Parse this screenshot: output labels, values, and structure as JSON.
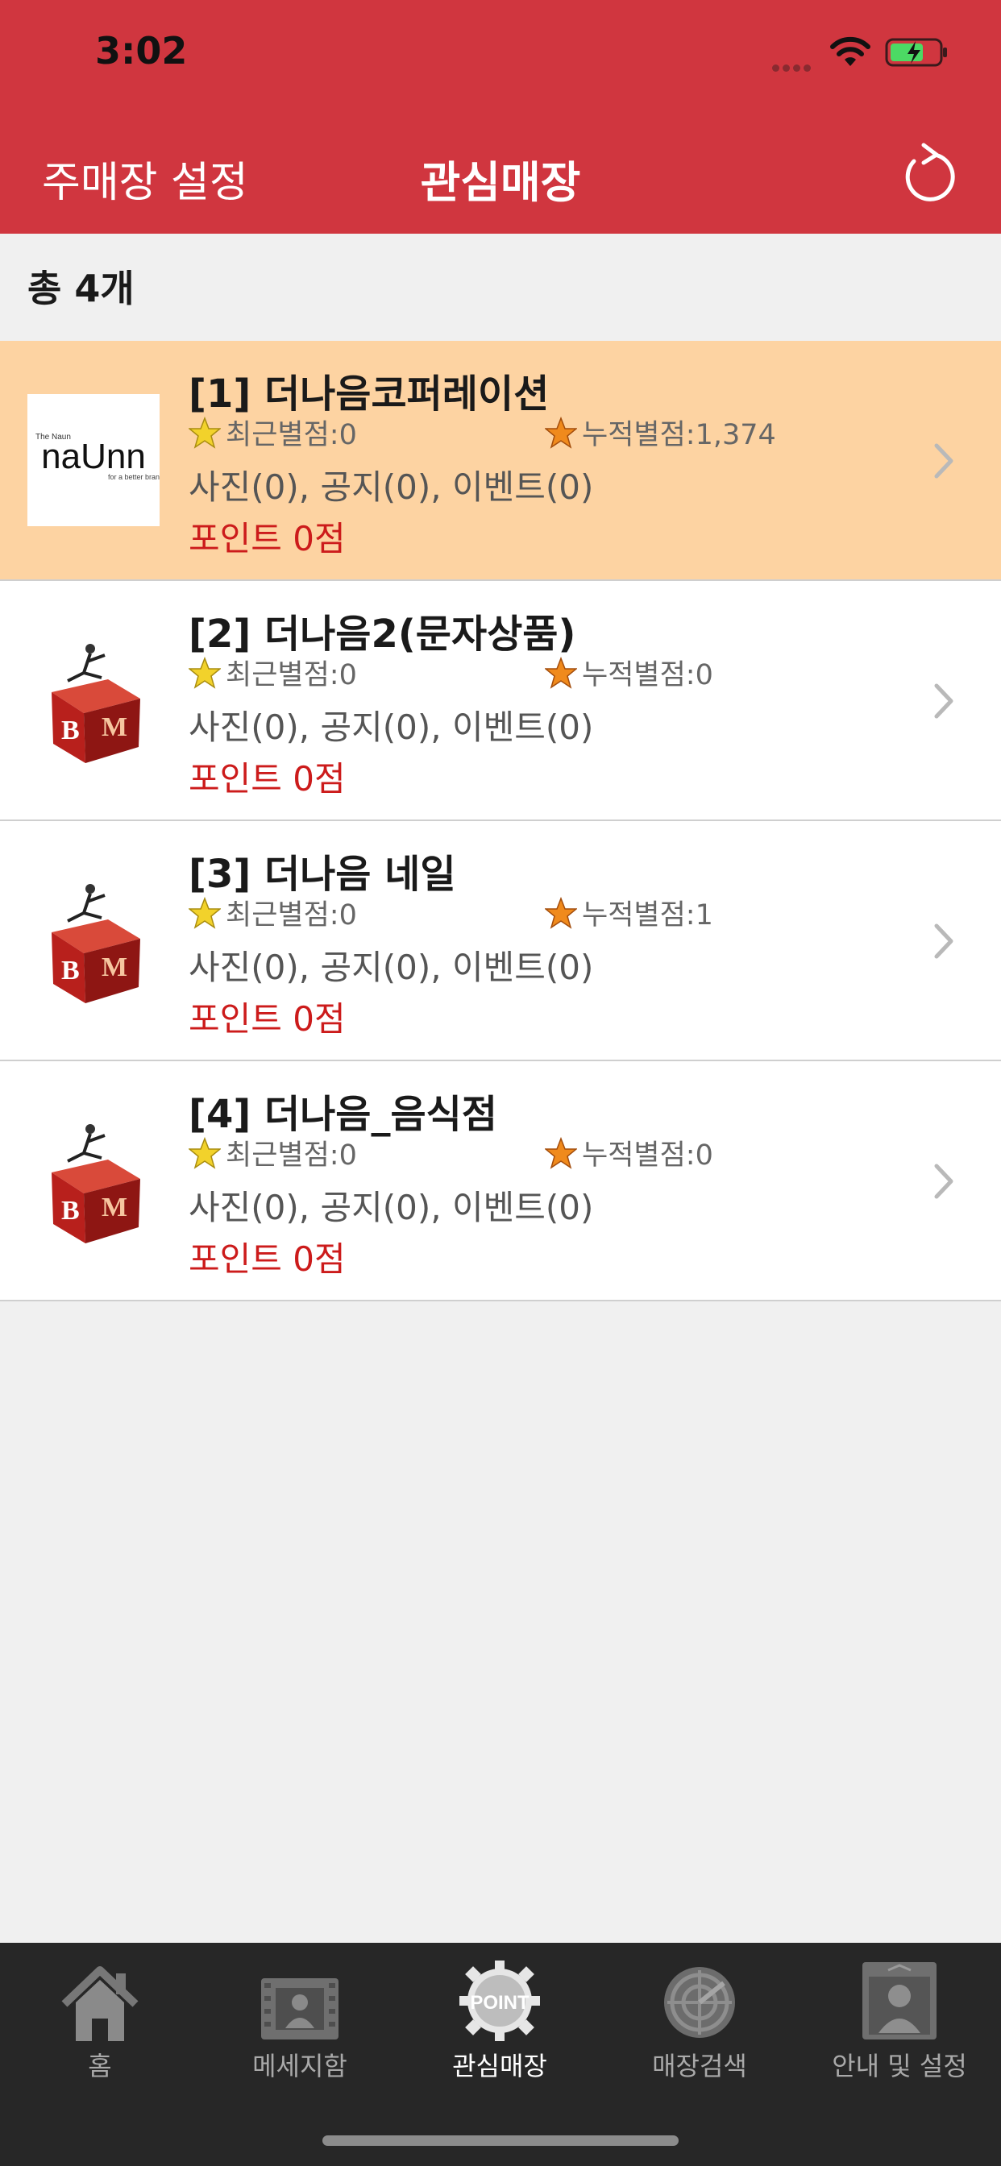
{
  "status_bar": {
    "time": "3:02"
  },
  "nav": {
    "left": "주매장 설정",
    "title": "관심매장",
    "refresh_icon": "refresh-icon"
  },
  "total_label": "총 4개",
  "stores": [
    {
      "title": "[1] 더나음코퍼레이션",
      "recent": "최근별점:0",
      "total": "누적별점:1,374",
      "counts": "사진(0), 공지(0), 이벤트(0)",
      "points": "포인트 0점",
      "logo": "naunn",
      "logo_text": "naUnn",
      "highlight": true
    },
    {
      "title": "[2] 더나음2(문자상품)",
      "recent": "최근별점:0",
      "total": "누적별점:0",
      "counts": "사진(0), 공지(0), 이벤트(0)",
      "points": "포인트 0점",
      "logo": "bm"
    },
    {
      "title": "[3] 더나음 네일",
      "recent": "최근별점:0",
      "total": "누적별점:1",
      "counts": "사진(0), 공지(0), 이벤트(0)",
      "points": "포인트 0점",
      "logo": "bm"
    },
    {
      "title": "[4] 더나음_음식점",
      "recent": "최근별점:0",
      "total": "누적별점:0",
      "counts": "사진(0), 공지(0), 이벤트(0)",
      "points": "포인트 0점",
      "logo": "bm"
    }
  ],
  "tabs": [
    {
      "label": "홈",
      "icon": "home-icon"
    },
    {
      "label": "메세지함",
      "icon": "message-icon"
    },
    {
      "label": "관심매장",
      "icon": "point-badge-icon",
      "active": true,
      "icon_text": "POINT"
    },
    {
      "label": "매장검색",
      "icon": "search-target-icon"
    },
    {
      "label": "안내 및 설정",
      "icon": "profile-settings-icon"
    }
  ],
  "colors": {
    "nav": "#d0363f",
    "highlight_row": "#fdd3a2",
    "points_text": "#cc1b1b",
    "tabbar": "#272727"
  }
}
